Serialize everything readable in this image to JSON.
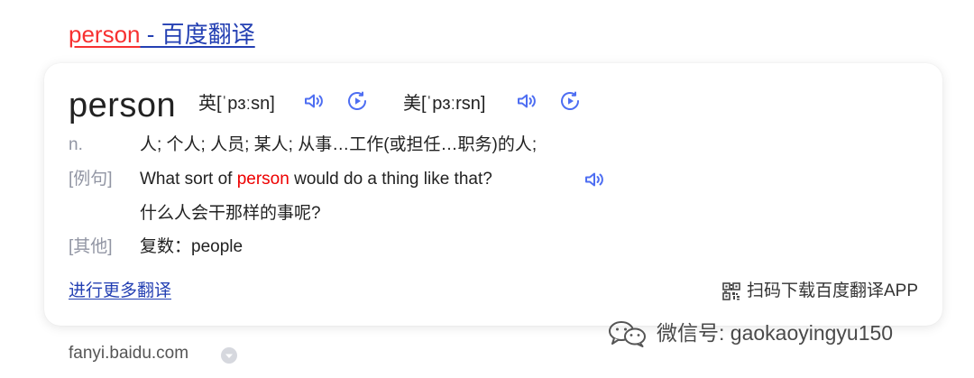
{
  "result": {
    "title_keyword": "person",
    "title_separator": " - ",
    "title_rest": "百度翻译"
  },
  "card": {
    "headword": "person",
    "uk_phonetic": "英[ˈpɜːsn]",
    "us_phonetic": "美[ˈpɜːrsn]",
    "definition": {
      "pos": "n.",
      "text": "人; 个人; 人员; 某人; 从事…工作(或担任…职务)的人;"
    },
    "example": {
      "label": "[例句]",
      "before": "What sort of ",
      "highlight": "person",
      "after": " would do a thing like that?",
      "translation": "什么人会干那样的事呢?"
    },
    "other": {
      "label": "[其他]",
      "text": "复数：people"
    },
    "more_link": "进行更多翻译",
    "app_download": "扫码下载百度翻译APP"
  },
  "watermark": {
    "text": "微信号: gaokaoyingyu150",
    "icon": "wechat-icon"
  },
  "source_url": "fanyi.baidu.com",
  "icons": [
    "speaker-icon",
    "play-icon",
    "qr-code-icon",
    "dropdown-arrow-icon",
    "wechat-icon"
  ],
  "colors": {
    "link": "#2440b3",
    "highlight": "#e00000",
    "icon_blue": "#4e6ef2",
    "label_gray": "#9195a3"
  }
}
